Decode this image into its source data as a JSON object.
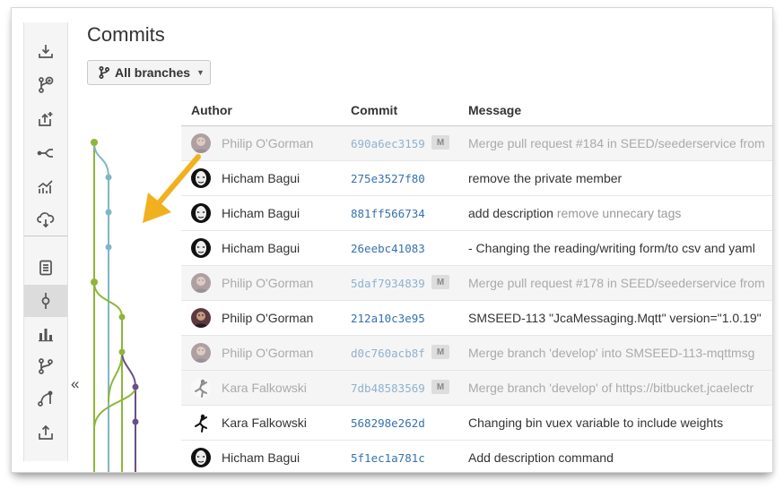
{
  "page": {
    "title": "Commits",
    "branch_selector": "All branches",
    "collapse_label": "«"
  },
  "sidebar": {
    "items": [
      {
        "icon": "clone-icon"
      },
      {
        "icon": "create-branch-icon"
      },
      {
        "icon": "create-pull-request-icon"
      },
      {
        "icon": "compare-icon"
      },
      {
        "icon": "insights-icon"
      },
      {
        "icon": "cloud-deploy-icon"
      },
      {
        "icon": "source-icon"
      },
      {
        "icon": "commits-icon",
        "active": true
      },
      {
        "icon": "statistics-icon"
      },
      {
        "icon": "branches-icon"
      },
      {
        "icon": "pull-requests-icon"
      },
      {
        "icon": "upload-icon"
      }
    ]
  },
  "table": {
    "headers": {
      "author": "Author",
      "commit": "Commit",
      "message": "Message"
    },
    "rows": [
      {
        "author": "Philip O'Gorman",
        "hash": "690a6ec3159",
        "merge": true,
        "badge": "M",
        "message": "Merge pull request #184 in SEED/seederservice from",
        "secondary": "",
        "avatar": "philip"
      },
      {
        "author": "Hicham Bagui",
        "hash": "275e3527f80",
        "merge": false,
        "badge": "",
        "message": "remove the private member",
        "secondary": "",
        "avatar": "hicham"
      },
      {
        "author": "Hicham Bagui",
        "hash": "881ff566734",
        "merge": false,
        "badge": "",
        "message": "add description",
        "secondary": "remove unnecary tags",
        "avatar": "hicham"
      },
      {
        "author": "Hicham Bagui",
        "hash": "26eebc41083",
        "merge": false,
        "badge": "",
        "message": "- Changing the reading/writing form/to csv and yaml",
        "secondary": "",
        "avatar": "hicham"
      },
      {
        "author": "Philip O'Gorman",
        "hash": "5daf7934839",
        "merge": true,
        "badge": "M",
        "message": "Merge pull request #178 in SEED/seederservice from",
        "secondary": "",
        "avatar": "philip"
      },
      {
        "author": "Philip O'Gorman",
        "hash": "212a10c3e95",
        "merge": false,
        "badge": "",
        "message": "SMSEED-113 \"JcaMessaging.Mqtt\" version=\"1.0.19\"",
        "secondary": "",
        "avatar": "philip"
      },
      {
        "author": "Philip O'Gorman",
        "hash": "d0c760acb8f",
        "merge": true,
        "badge": "M",
        "message": "Merge branch 'develop' into SMSEED-113-mqttmsg",
        "secondary": "",
        "avatar": "philip"
      },
      {
        "author": "Kara Falkowski",
        "hash": "7db48583569",
        "merge": true,
        "badge": "M",
        "message": "Merge branch 'develop' of https://bitbucket.jcaelectr",
        "secondary": "",
        "avatar": "kara"
      },
      {
        "author": "Kara Falkowski",
        "hash": "568298e262d",
        "merge": false,
        "badge": "",
        "message": "Changing bin vuex variable to include weights",
        "secondary": "",
        "avatar": "kara"
      },
      {
        "author": "Hicham Bagui",
        "hash": "5f1ec1a781c",
        "merge": false,
        "badge": "",
        "message": "Add description command",
        "secondary": "",
        "avatar": "hicham"
      }
    ]
  },
  "colors": {
    "accent": "#3572b0",
    "branch_green": "#8db63a",
    "branch_teal": "#80b6c7",
    "branch_purple": "#6a4e8a",
    "annotation_arrow": "#f2b01e"
  }
}
